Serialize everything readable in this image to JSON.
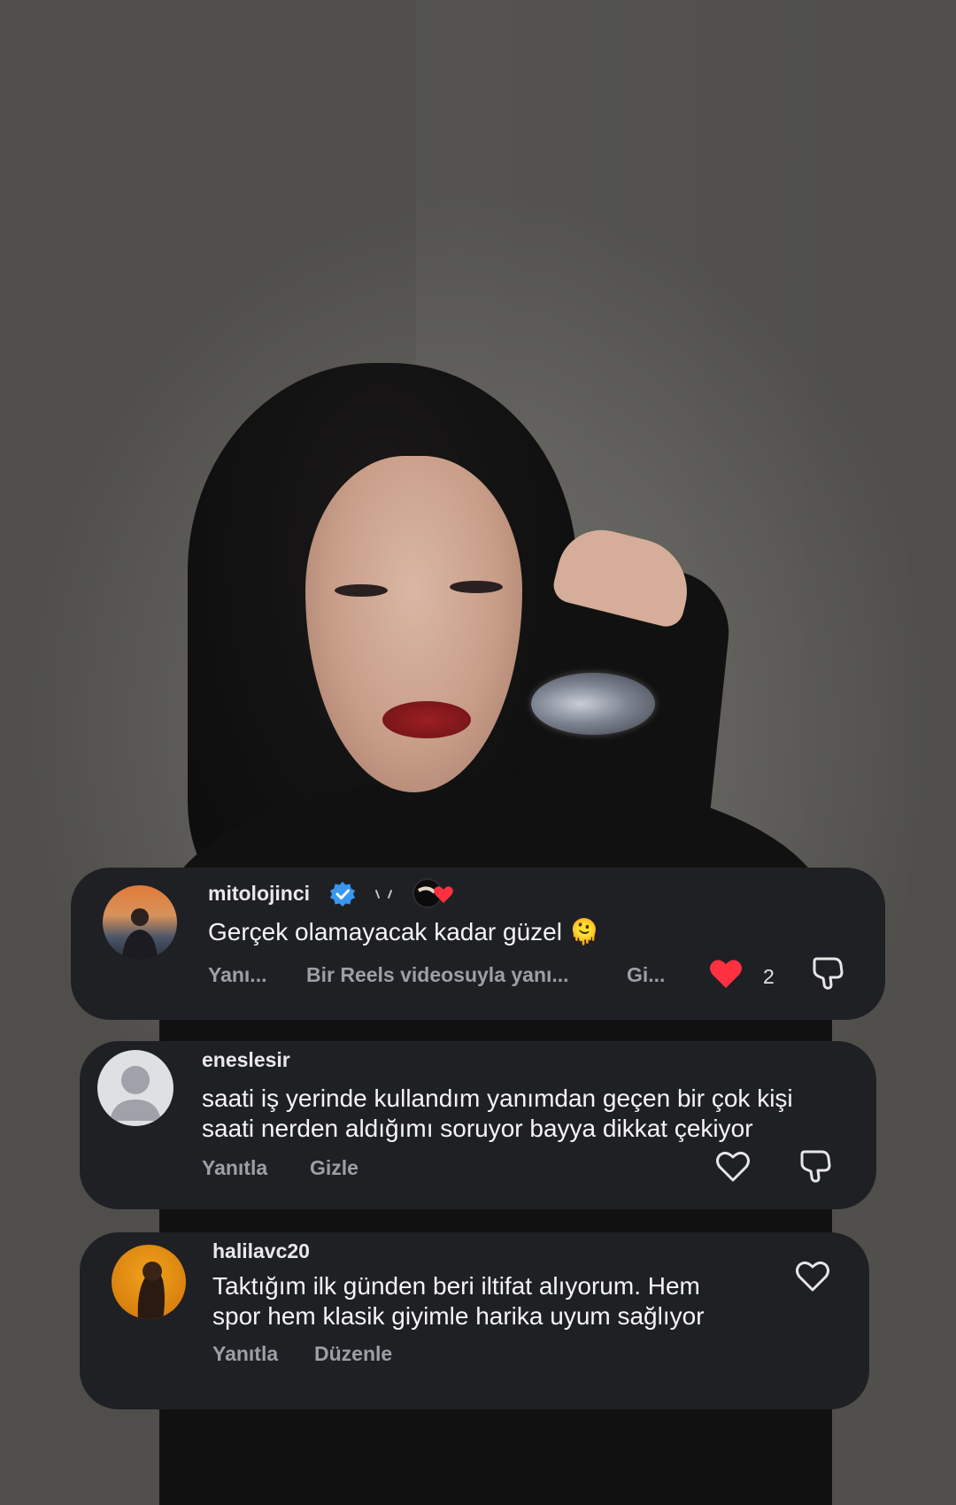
{
  "comments": [
    {
      "username": "mitolojinci",
      "text": "Gerçek olamayacak kadar güzel 🫠",
      "actions": [
        "Yanı...",
        "Bir Reels videosuyla yanı...",
        "Gi..."
      ],
      "like_count": "2",
      "liked": true,
      "verified": true
    },
    {
      "username": "eneslesir",
      "text_lines": [
        "saati iş yerinde kullandım yanımdan geçen bir çok kişi",
        "saati nerden aldığımı soruyor bayya dikkat çekiyor"
      ],
      "actions": [
        "Yanıtla",
        "Gizle"
      ]
    },
    {
      "username": "halilavc20",
      "text_lines": [
        "Taktığım ilk günden beri iltifat alıyorum. Hem",
        "spor hem klasik giyimle harika uyum sağlıyor"
      ],
      "actions": [
        "Yanıtla",
        "Düzenle"
      ]
    }
  ],
  "colors": {
    "card_bg": "#1f2024",
    "like_red": "#ff3040",
    "verified_blue": "#3897f0",
    "muted": "#9d9fa6"
  },
  "icons": [
    "verified-badge-icon",
    "heart-filled-icon",
    "heart-outline-icon",
    "dislike-icon",
    "default-avatar-icon"
  ]
}
